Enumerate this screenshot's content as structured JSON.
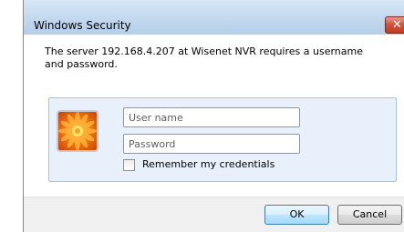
{
  "window": {
    "title": "Windows Security",
    "close_icon": "close-icon"
  },
  "message": "The server 192.168.4.207 at Wisenet NVR requires a username and password.",
  "credentials": {
    "avatar_icon": "user-flower-avatar-icon",
    "username": {
      "value": "",
      "placeholder": "User name"
    },
    "password": {
      "value": "",
      "placeholder": "Password"
    },
    "remember_label": "Remember my credentials",
    "remember_checked": false
  },
  "buttons": {
    "ok_label": "OK",
    "cancel_label": "Cancel"
  },
  "colors": {
    "titlebar": "#c3d8ee",
    "panel": "#e8f0fb",
    "close_button": "#c53a22",
    "ok_border": "#3c7fb1"
  }
}
